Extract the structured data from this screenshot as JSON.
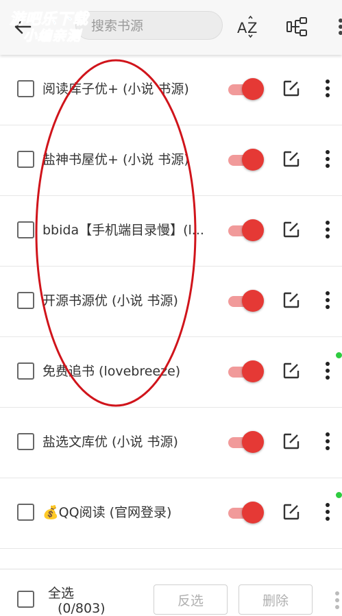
{
  "watermark": {
    "line1": "游吧乐下载",
    "line2": "小编亲测"
  },
  "search": {
    "placeholder": "搜索书源"
  },
  "icons": {
    "back": "arrow-back-icon",
    "sort": "sort-az-icon",
    "group": "group-icon",
    "more": "more-vertical-icon",
    "edit": "edit-icon",
    "emoji": "money-bag-icon"
  },
  "sources": [
    {
      "name": "阅读库子优+ (小说 书源)",
      "enabled": true,
      "new_dot": false
    },
    {
      "name": "盐神书屋优+ (小说 书源)",
      "enabled": true,
      "new_dot": false
    },
    {
      "name": "bbida【手机端目录慢】(l...",
      "enabled": true,
      "new_dot": false
    },
    {
      "name": "开源书源优 (小说 书源)",
      "enabled": true,
      "new_dot": false
    },
    {
      "name": "免费追书 (lovebreeze)",
      "enabled": true,
      "new_dot": true
    },
    {
      "name": "盐选文库优 (小说 书源)",
      "enabled": true,
      "new_dot": false
    },
    {
      "name": "💰QQ阅读 (官网登录)",
      "enabled": true,
      "new_dot": true
    }
  ],
  "footer": {
    "select_all": "全选",
    "count": "(0/803)",
    "invert": "反选",
    "delete": "删除"
  },
  "colors": {
    "accent": "#e53935",
    "track": "#f19a9a",
    "dot": "#2ecc40",
    "annotation": "#d0141b",
    "watermark": "#1aa4e8"
  }
}
